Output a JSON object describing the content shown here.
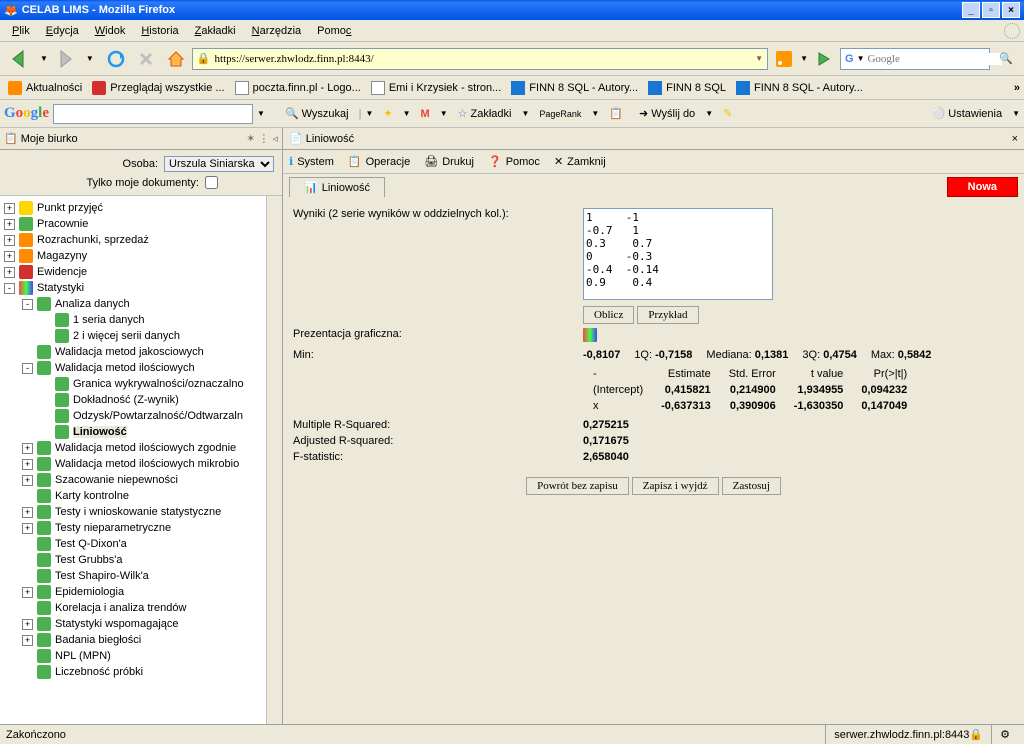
{
  "window": {
    "title": "CELAB LIMS - Mozilla Firefox"
  },
  "menubar": [
    "Plik",
    "Edycja",
    "Widok",
    "Historia",
    "Zakładki",
    "Narzędzia",
    "Pomoc"
  ],
  "url": "https://serwer.zhwlodz.finn.pl:8443/",
  "search_placeholder": "Google",
  "bookmarks": [
    {
      "label": "Aktualności"
    },
    {
      "label": "Przeglądaj wszystkie ..."
    },
    {
      "label": "poczta.finn.pl - Logo..."
    },
    {
      "label": "Emi i Krzysiek - stron..."
    },
    {
      "label": "FINN 8 SQL - Autory..."
    },
    {
      "label": "FINN 8 SQL"
    },
    {
      "label": "FINN 8 SQL - Autory..."
    }
  ],
  "googlebar": {
    "search_btn": "Wyszukaj",
    "bookmarks": "Zakładki",
    "pagerank": "PageRank",
    "send": "Wyślij do",
    "settings": "Ustawienia"
  },
  "sidebar": {
    "title": "Moje biurko",
    "osoba_label": "Osoba:",
    "osoba_value": "Urszula Siniarska",
    "tylko_label": "Tylko moje dokumenty:",
    "tree": [
      {
        "indent": 0,
        "twisty": "+",
        "icon": "yellow",
        "label": "Punkt przyjęć"
      },
      {
        "indent": 0,
        "twisty": "+",
        "icon": "green",
        "label": "Pracownie"
      },
      {
        "indent": 0,
        "twisty": "+",
        "icon": "orange",
        "label": "Rozrachunki, sprzedaż"
      },
      {
        "indent": 0,
        "twisty": "+",
        "icon": "orange",
        "label": "Magazyny"
      },
      {
        "indent": 0,
        "twisty": "+",
        "icon": "red",
        "label": "Ewidencje"
      },
      {
        "indent": 0,
        "twisty": "-",
        "icon": "chart",
        "label": "Statystyki"
      },
      {
        "indent": 1,
        "twisty": "-",
        "icon": "green",
        "label": "Analiza danych"
      },
      {
        "indent": 2,
        "twisty": "",
        "icon": "green",
        "label": "1 seria danych"
      },
      {
        "indent": 2,
        "twisty": "",
        "icon": "green",
        "label": "2 i więcej serii danych"
      },
      {
        "indent": 1,
        "twisty": "",
        "icon": "green",
        "label": "Walidacja metod jakosciowych"
      },
      {
        "indent": 1,
        "twisty": "-",
        "icon": "green",
        "label": "Walidacja metod ilościowych"
      },
      {
        "indent": 2,
        "twisty": "",
        "icon": "green",
        "label": "Granica wykrywalności/oznaczalno"
      },
      {
        "indent": 2,
        "twisty": "",
        "icon": "green",
        "label": "Dokładność (Z-wynik)"
      },
      {
        "indent": 2,
        "twisty": "",
        "icon": "green",
        "label": "Odzysk/Powtarzalność/Odtwarzaln"
      },
      {
        "indent": 2,
        "twisty": "",
        "icon": "green",
        "label": "Liniowość",
        "selected": true
      },
      {
        "indent": 1,
        "twisty": "+",
        "icon": "green",
        "label": "Walidacja metod ilościowych zgodnie"
      },
      {
        "indent": 1,
        "twisty": "+",
        "icon": "green",
        "label": "Walidacja metod ilościowych mikrobio"
      },
      {
        "indent": 1,
        "twisty": "+",
        "icon": "green",
        "label": "Szacowanie niepewności"
      },
      {
        "indent": 1,
        "twisty": "",
        "icon": "green",
        "label": "Karty kontrolne"
      },
      {
        "indent": 1,
        "twisty": "+",
        "icon": "green",
        "label": "Testy i wnioskowanie statystyczne"
      },
      {
        "indent": 1,
        "twisty": "+",
        "icon": "green",
        "label": "Testy nieparametryczne"
      },
      {
        "indent": 1,
        "twisty": "",
        "icon": "green",
        "label": "Test Q-Dixon'a"
      },
      {
        "indent": 1,
        "twisty": "",
        "icon": "green",
        "label": "Test Grubbs'a"
      },
      {
        "indent": 1,
        "twisty": "",
        "icon": "green",
        "label": "Test Shapiro-Wilk'a"
      },
      {
        "indent": 1,
        "twisty": "+",
        "icon": "green",
        "label": "Epidemiologia"
      },
      {
        "indent": 1,
        "twisty": "",
        "icon": "green",
        "label": "Korelacja i analiza trendów"
      },
      {
        "indent": 1,
        "twisty": "+",
        "icon": "green",
        "label": "Statystyki wspomagające"
      },
      {
        "indent": 1,
        "twisty": "+",
        "icon": "green",
        "label": "Badania biegłości"
      },
      {
        "indent": 1,
        "twisty": "",
        "icon": "green",
        "label": "NPL (MPN)"
      },
      {
        "indent": 1,
        "twisty": "",
        "icon": "green",
        "label": "Liczebność próbki"
      }
    ]
  },
  "content": {
    "title": "Liniowość",
    "toolbar": {
      "system": "System",
      "operacje": "Operacje",
      "drukuj": "Drukuj",
      "pomoc": "Pomoc",
      "zamknij": "Zamknij"
    },
    "tab": "Liniowość",
    "btn_new": "Nowa",
    "lbl_wyniki": "Wyniki (2 serie wyników w oddzielnych kol.):",
    "wyniki_data": "1     -1\n-0.7   1\n0.3    0.7\n0     -0.3\n-0.4  -0.14\n0.9    0.4",
    "btn_oblicz": "Oblicz",
    "btn_przyklad": "Przykład",
    "lbl_prezentacja": "Prezentacja graficzna:",
    "lbl_min": "Min:",
    "summary": {
      "min": "-0,8107",
      "q1_lbl": "1Q:",
      "q1": "-0,7158",
      "med_lbl": "Mediana:",
      "med": "0,1381",
      "q3_lbl": "3Q:",
      "q3": "0,4754",
      "max_lbl": "Max:",
      "max": "0,5842"
    },
    "coef": {
      "dash": "-",
      "h_est": "Estimate",
      "h_se": "Std. Error",
      "h_t": "t value",
      "h_p": "Pr(>|t|)",
      "r1_lbl": "(Intercept)",
      "r1_est": "0,415821",
      "r1_se": "0,214900",
      "r1_t": "1,934955",
      "r1_p": "0,094232",
      "r2_lbl": "x",
      "r2_est": "-0,637313",
      "r2_se": "0,390906",
      "r2_t": "-1,630350",
      "r2_p": "0,147049"
    },
    "lbl_multr": "Multiple R-Squared:",
    "val_multr": "0,275215",
    "lbl_adjr": "Adjusted R-squared:",
    "val_adjr": "0,171675",
    "lbl_fstat": "F-statistic:",
    "val_fstat": "2,658040",
    "btn_powrot": "Powrót bez zapisu",
    "btn_zapisz": "Zapisz i wyjdź",
    "btn_zastosuj": "Zastosuj"
  },
  "status": {
    "left": "Zakończono",
    "right": "serwer.zhwlodz.finn.pl:8443"
  }
}
